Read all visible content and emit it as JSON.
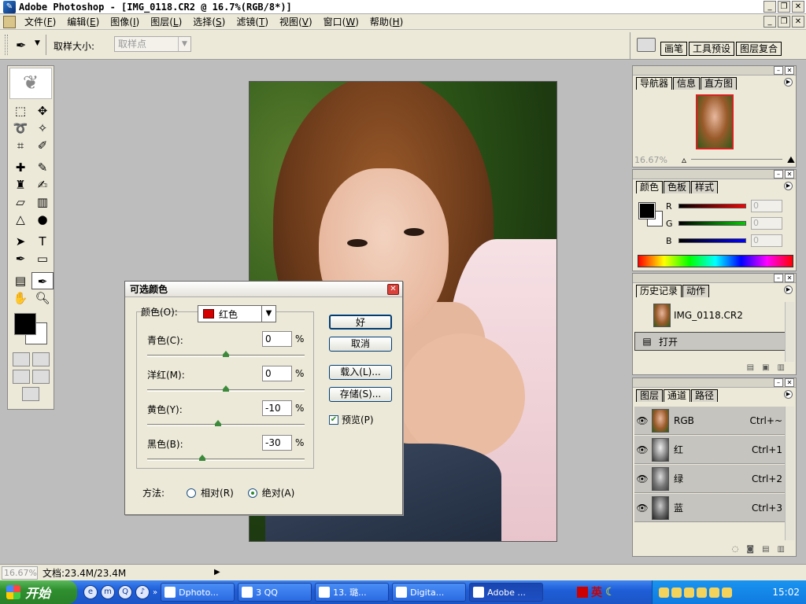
{
  "window": {
    "title": "Adobe Photoshop - [IMG_0118.CR2 @ 16.7%(RGB/8*)]"
  },
  "menu": [
    {
      "label": "文件",
      "key": "F"
    },
    {
      "label": "编辑",
      "key": "E"
    },
    {
      "label": "图像",
      "key": "I"
    },
    {
      "label": "图层",
      "key": "L"
    },
    {
      "label": "选择",
      "key": "S"
    },
    {
      "label": "滤镜",
      "key": "T"
    },
    {
      "label": "视图",
      "key": "V"
    },
    {
      "label": "窗口",
      "key": "W"
    },
    {
      "label": "帮助",
      "key": "H"
    }
  ],
  "options": {
    "sample_label": "取样大小:",
    "sample_value": "取样点",
    "well_tabs": [
      "画笔",
      "工具预设",
      "图层复合"
    ]
  },
  "dialog": {
    "title": "可选颜色",
    "color_label": "颜色(O):",
    "color_value": "红色",
    "color_hex": "#d40000",
    "sliders": [
      {
        "label": "青色(C):",
        "value": "0",
        "pct": 0.0
      },
      {
        "label": "洋红(M):",
        "value": "0",
        "pct": 0.0
      },
      {
        "label": "黄色(Y):",
        "value": "-10",
        "pct": -0.1
      },
      {
        "label": "黑色(B):",
        "value": "-30",
        "pct": -0.3
      }
    ],
    "percent": "%",
    "buttons": {
      "ok": "好",
      "cancel": "取消",
      "load": "载入(L)...",
      "save": "存储(S)..."
    },
    "preview_label": "预览(P)",
    "method_label": "方法:",
    "method_relative": "相对(R)",
    "method_absolute": "绝对(A)"
  },
  "navigator": {
    "tabs": [
      "导航器",
      "信息",
      "直方图"
    ],
    "zoom": "16.67%"
  },
  "color_panel": {
    "tabs": [
      "颜色",
      "色板",
      "样式"
    ],
    "channels": [
      {
        "label": "R",
        "value": "0"
      },
      {
        "label": "G",
        "value": "0"
      },
      {
        "label": "B",
        "value": "0"
      }
    ]
  },
  "history": {
    "tabs": [
      "历史记录",
      "动作"
    ],
    "snapshot": "IMG_0118.CR2",
    "step": "打开"
  },
  "layers": {
    "tabs": [
      "图层",
      "通道",
      "路径"
    ],
    "channels": [
      {
        "name": "RGB",
        "key": "Ctrl+~"
      },
      {
        "name": "红",
        "key": "Ctrl+1"
      },
      {
        "name": "绿",
        "key": "Ctrl+2"
      },
      {
        "name": "蓝",
        "key": "Ctrl+3"
      }
    ]
  },
  "status": {
    "zoom": "16.67%",
    "doc": "文档:23.4M/23.4M"
  },
  "taskbar": {
    "start": "开始",
    "tasks": [
      "Dphoto...",
      "3 QQ",
      "13. 璐...",
      "Digita...",
      "Adobe ..."
    ],
    "ime": "英",
    "clock": "15:02"
  }
}
